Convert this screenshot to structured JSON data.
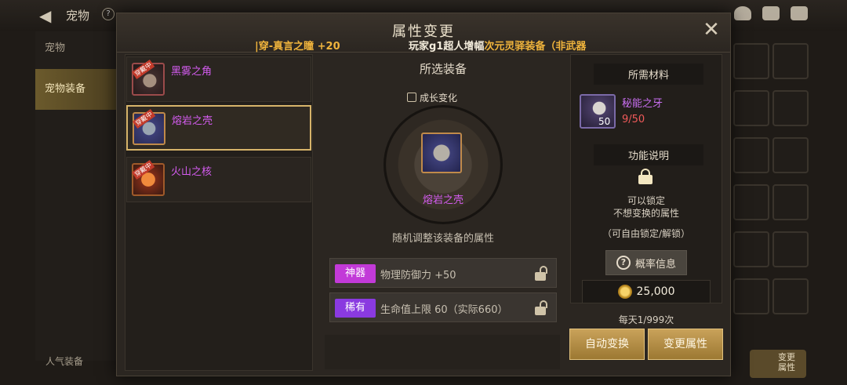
{
  "background": {
    "title": "宠物",
    "tabs": [
      "宠物",
      "宠物装备"
    ],
    "bottom_left_label": "人气装备",
    "right_button_label": "变更\n属性"
  },
  "modal": {
    "title": "属性变更",
    "marquee": {
      "part_a": "|穿-真言之瞳 +20",
      "part_b_prefix": "玩家g1超人增幅",
      "part_b_highlight": "次元灵驿装备（非武器"
    }
  },
  "equipment_list": [
    {
      "name": "黑雾之角",
      "tag": "穿戴中",
      "icon": "horn-icon"
    },
    {
      "name": "熔岩之壳",
      "tag": "穿戴中",
      "icon": "shell-icon",
      "selected": true
    },
    {
      "name": "火山之核",
      "tag": "穿戴中",
      "icon": "core-icon"
    }
  ],
  "selected": {
    "section_title": "所选装备",
    "growth_label": "成长变化",
    "item_name": "熔岩之壳",
    "description": "随机调整该装备的属性",
    "attributes": [
      {
        "grade": "神器",
        "grade_color": "#c23ad8",
        "text": "物理防御力 +50"
      },
      {
        "grade": "稀有",
        "grade_color": "#8a3ae0",
        "text": "生命值上限 60（实际660）"
      }
    ]
  },
  "materials": {
    "section_title": "所需材料",
    "item_name": "秘能之牙",
    "count_badge": "50",
    "progress": "9/50"
  },
  "function": {
    "section_title": "功能说明",
    "line1": "可以锁定",
    "line2": "不想变换的属性",
    "sub": "（可自由锁定/解锁）"
  },
  "probability_button": "概率信息",
  "cost": "25,000",
  "daily_limit": "每天1/999次",
  "buttons": {
    "auto": "自动变换",
    "change": "变更属性"
  }
}
